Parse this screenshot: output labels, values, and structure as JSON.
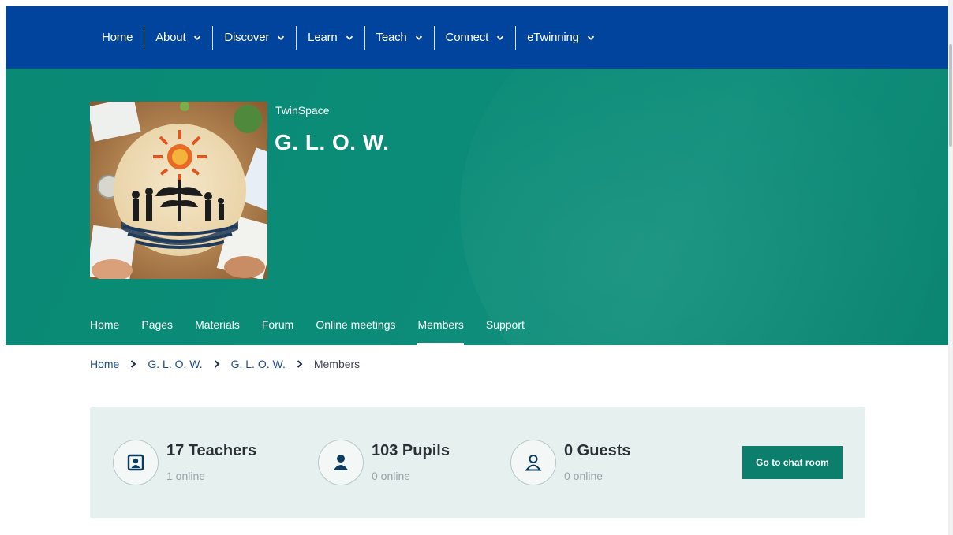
{
  "topnav": {
    "items": [
      {
        "label": "Home",
        "has_menu": false
      },
      {
        "label": "About",
        "has_menu": true
      },
      {
        "label": "Discover",
        "has_menu": true
      },
      {
        "label": "Learn",
        "has_menu": true
      },
      {
        "label": "Teach",
        "has_menu": true
      },
      {
        "label": "Connect",
        "has_menu": true
      },
      {
        "label": "eTwinning",
        "has_menu": true
      }
    ]
  },
  "hero": {
    "kicker": "TwinSpace",
    "title": "G. L. O. W.",
    "subnav": [
      {
        "label": "Home",
        "active": false
      },
      {
        "label": "Pages",
        "active": false
      },
      {
        "label": "Materials",
        "active": false
      },
      {
        "label": "Forum",
        "active": false
      },
      {
        "label": "Online meetings",
        "active": false
      },
      {
        "label": "Members",
        "active": true
      },
      {
        "label": "Support",
        "active": false
      }
    ]
  },
  "breadcrumb": {
    "items": [
      "Home",
      "G. L. O. W.",
      "G. L. O. W.",
      "Members"
    ]
  },
  "stats": {
    "teachers": {
      "count": "17 Teachers",
      "online": "1 online",
      "icon": "teacher-icon"
    },
    "pupils": {
      "count": "103 Pupils",
      "online": "0 online",
      "icon": "pupil-icon"
    },
    "guests": {
      "count": "0 Guests",
      "online": "0 online",
      "icon": "guest-icon"
    },
    "chat_button": "Go to chat room"
  },
  "colors": {
    "topnav_bg": "#00449e",
    "hero_bg": "#0b8c78",
    "stats_bg": "#e6f1ef",
    "button_bg": "#0b7f6c",
    "link": "#1f4f8c"
  }
}
